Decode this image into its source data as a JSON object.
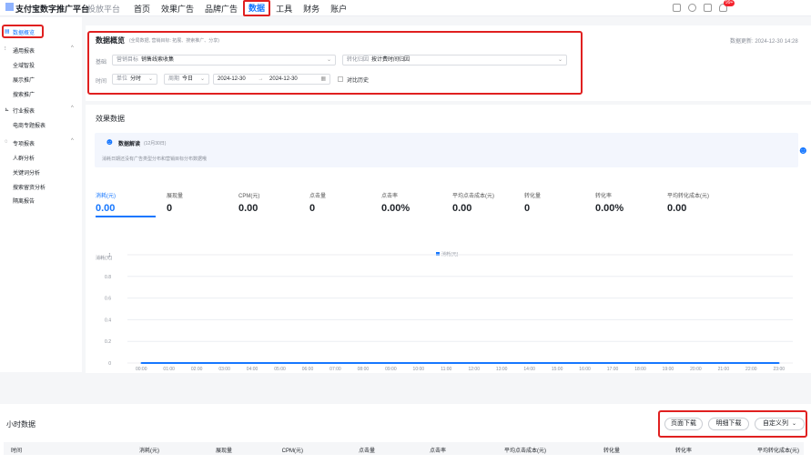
{
  "header": {
    "brand": "支付宝数字推广平台",
    "brand_sub": "投放平台",
    "nav": [
      "首页",
      "效果广告",
      "品牌广告",
      "数据",
      "工具",
      "财务",
      "账户"
    ],
    "active_nav": "数据",
    "notification_count": "99+"
  },
  "sidebar": {
    "active": "数据概览",
    "groups": [
      {
        "title": "通用报表",
        "items": [
          "全域智投",
          "展示推广",
          "搜索推广"
        ]
      },
      {
        "title": "行业报表",
        "items": [
          "电商专题报表"
        ]
      },
      {
        "title": "专项报表",
        "items": [
          "人群分析",
          "关键词分析",
          "搜索留资分析",
          "隔离报告"
        ]
      }
    ]
  },
  "overview": {
    "title": "数据概览",
    "subtitle": "(全局数据, 营销目标: 拓展、搜索推广、分享)",
    "update_time": "数据更新: 2024-12-30 14:28",
    "filter_label_target": "基础",
    "marketing_target_label": "营销目标",
    "marketing_target_value": "销售线索收集",
    "conversion_label": "转化归因",
    "conversion_value": "按计费时间归因",
    "time_label": "时间",
    "unit_label": "单位",
    "unit_value": "分时",
    "period_label": "周期",
    "period_value": "今日",
    "date_start": "2024-12-30",
    "date_sep": "→",
    "date_end": "2024-12-30",
    "compare_label": "对比历史"
  },
  "effect": {
    "title": "效果数据",
    "insight_title": "数据解读",
    "insight_sub": "(12月30日)",
    "insight_text": "消耗日期还没有广告类型分布和营销目标分布数据哦",
    "metrics": [
      {
        "label": "消耗(元)",
        "value": "0.00"
      },
      {
        "label": "展现量",
        "value": "0"
      },
      {
        "label": "CPM(元)",
        "value": "0.00"
      },
      {
        "label": "点击量",
        "value": "0"
      },
      {
        "label": "点击率",
        "value": "0.00%"
      },
      {
        "label": "平均点击成本(元)",
        "value": "0.00"
      },
      {
        "label": "转化量",
        "value": "0"
      },
      {
        "label": "转化率",
        "value": "0.00%"
      },
      {
        "label": "平均转化成本(元)",
        "value": "0.00"
      }
    ],
    "selected_metric": "消耗(元)"
  },
  "chart_data": {
    "type": "line",
    "ylabel": "消耗(元)",
    "legend": "消耗(元)",
    "legend_position": "top-center",
    "ylim": [
      0,
      1
    ],
    "y_ticks": [
      "0",
      "0.2",
      "0.4",
      "0.6",
      "0.8",
      "1"
    ],
    "x": [
      "00:00",
      "01:00",
      "02:00",
      "03:00",
      "04:00",
      "05:00",
      "06:00",
      "07:00",
      "08:00",
      "09:00",
      "10:00",
      "11:00",
      "12:00",
      "13:00",
      "14:00",
      "15:00",
      "16:00",
      "17:00",
      "18:00",
      "19:00",
      "20:00",
      "21:00",
      "22:00",
      "23:00"
    ],
    "series": [
      {
        "name": "消耗(元)",
        "values": [
          0,
          0,
          0,
          0,
          0,
          0,
          0,
          0,
          0,
          0,
          0,
          0,
          0,
          0,
          0,
          0,
          0,
          0,
          0,
          0,
          0,
          0,
          0,
          0
        ]
      }
    ],
    "grid": true,
    "color": "#1677ff"
  },
  "hourly": {
    "title": "小时数据",
    "buttons": [
      "页面下载",
      "明细下载",
      "自定义列"
    ],
    "columns": [
      "时间",
      "消耗(元)",
      "展现量",
      "CPM(元)",
      "点击量",
      "点击率",
      "平均点击成本(元)",
      "转化量",
      "转化率",
      "平均转化成本(元)"
    ]
  },
  "colors": {
    "accent": "#1677ff",
    "highlight": "#e02020"
  }
}
